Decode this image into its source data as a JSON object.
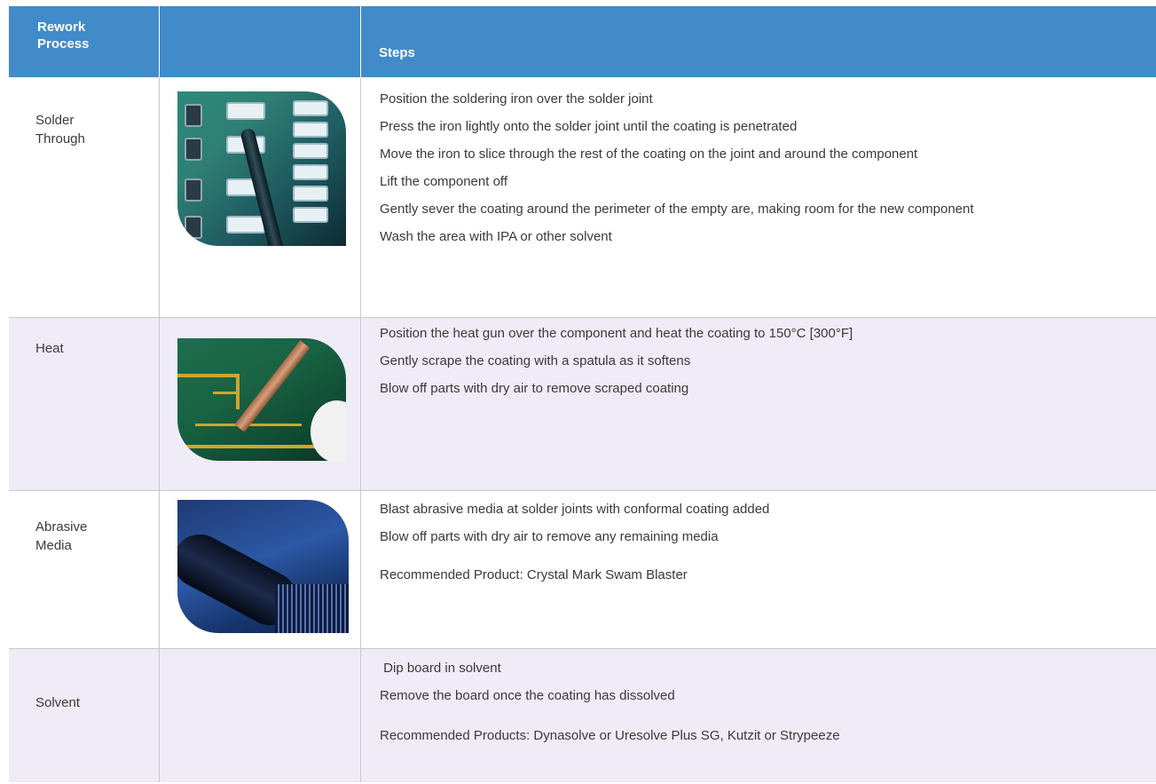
{
  "header": {
    "process_label": "Rework Process",
    "image_label": "",
    "steps_label": "Steps"
  },
  "rows": [
    {
      "process": "Solder Through",
      "image": "pcb-soldering-iron-photo",
      "steps": [
        "Position the soldering iron over the solder joint",
        "Press the iron lightly onto the solder joint until the coating is penetrated",
        "Move the iron to slice through the rest of the coating on the joint and around the component",
        "Lift the component off",
        "Gently sever the coating around the perimeter of the empty are, making room for the new component",
        "Wash the area with IPA or other solvent"
      ],
      "recommended": ""
    },
    {
      "process": "Heat",
      "image": "pcb-heat-spatula-photo",
      "steps": [
        "Position the heat gun over the component and heat the coating to 150°C [300°F]",
        "Gently scrape the coating with a spatula as it softens",
        "Blow off parts with dry air to remove scraped coating"
      ],
      "recommended": ""
    },
    {
      "process": "Abrasive Media",
      "image": "abrasive-blaster-photo",
      "steps": [
        "Blast abrasive media at solder joints with conformal coating added",
        "Blow off parts with dry air to remove any remaining media"
      ],
      "recommended": "Recommended Product: Crystal Mark Swam Blaster"
    },
    {
      "process": "Solvent",
      "image": "",
      "steps": [
        " Dip board in solvent",
        "Remove the board once the coating has dissolved"
      ],
      "recommended": "Recommended Products: Dynasolve or Uresolve Plus SG, Kutzit or Strypeeze"
    }
  ],
  "colors": {
    "header_bg": "#428bca",
    "alt_row_bg": "#efebf7",
    "text": "#3a3a3a"
  }
}
